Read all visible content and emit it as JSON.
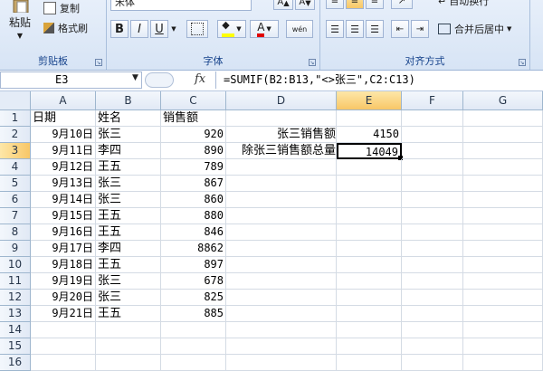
{
  "ribbon": {
    "clipboard": {
      "label": "剪贴板",
      "paste_label": "粘贴",
      "copy_label": "复制",
      "format_painter_label": "格式刷"
    },
    "font": {
      "label": "字体",
      "font_name": "宋体",
      "bold": "B",
      "italic": "I",
      "underline": "U",
      "font_color_glyph": "A",
      "phonetic_glyph": "wén"
    },
    "alignment": {
      "label": "对齐方式",
      "wrap_text_label": "自动换行",
      "merge_label": "合并后居中"
    }
  },
  "namebox": {
    "value": "E3"
  },
  "formula_bar": {
    "fx": "fx",
    "formula": "=SUMIF(B2:B13,\"<>张三\",C2:C13)"
  },
  "columns": [
    "A",
    "B",
    "C",
    "D",
    "E",
    "F",
    "G"
  ],
  "rows": [
    "1",
    "2",
    "3",
    "4",
    "5",
    "6",
    "7",
    "8",
    "9",
    "10",
    "11",
    "12",
    "13",
    "14",
    "15",
    "16"
  ],
  "sheet": {
    "headers": {
      "date": "日期",
      "name": "姓名",
      "sales": "销售额"
    },
    "records": [
      {
        "date": "9月10日",
        "name": "张三",
        "sales": "920"
      },
      {
        "date": "9月11日",
        "name": "李四",
        "sales": "890"
      },
      {
        "date": "9月12日",
        "name": "王五",
        "sales": "789"
      },
      {
        "date": "9月13日",
        "name": "张三",
        "sales": "867"
      },
      {
        "date": "9月14日",
        "name": "张三",
        "sales": "860"
      },
      {
        "date": "9月15日",
        "name": "王五",
        "sales": "880"
      },
      {
        "date": "9月16日",
        "name": "王五",
        "sales": "846"
      },
      {
        "date": "9月17日",
        "name": "李四",
        "sales": "8862"
      },
      {
        "date": "9月18日",
        "name": "王五",
        "sales": "897"
      },
      {
        "date": "9月19日",
        "name": "张三",
        "sales": "678"
      },
      {
        "date": "9月20日",
        "name": "张三",
        "sales": "825"
      },
      {
        "date": "9月21日",
        "name": "王五",
        "sales": "885"
      }
    ],
    "summary": [
      {
        "label": "张三销售额",
        "value": "4150"
      },
      {
        "label": "除张三销售额总量",
        "value": "14049"
      }
    ]
  },
  "selection": {
    "column": "E",
    "row": "3"
  }
}
